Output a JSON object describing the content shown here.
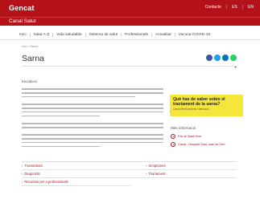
{
  "header": {
    "logo": "Gencat",
    "links": [
      "Contacte",
      "ES",
      "EN"
    ],
    "site_title": "Canal Salut"
  },
  "nav": {
    "items": [
      "Inici",
      "Salut A-Z",
      "Vida saludable",
      "Sistema de salut",
      "Professionals",
      "Actualitat",
      "Vacuna COVID-19"
    ]
  },
  "page": {
    "breadcrumb": "Inici > Sarna",
    "title": "Sarna",
    "section_label": "Escabiosi"
  },
  "share": {
    "colors": [
      "#3b5998",
      "#1da1f2",
      "#0077b5",
      "#25d366"
    ]
  },
  "sidebar": {
    "question": "Què has de saber sobre el tractament de la sarna?",
    "question_source": "Canal Medicaments i farmàcia",
    "more_info_title": "Més informació",
    "links": [
      "Fes-te Salut Mou",
      "Canal - Hospital Sant Joan de Déu"
    ]
  },
  "related": {
    "links": [
      "Transmissió",
      "Símptomes",
      "Diagnòstic",
      "Tractament",
      "Recursos per a professionals"
    ]
  }
}
